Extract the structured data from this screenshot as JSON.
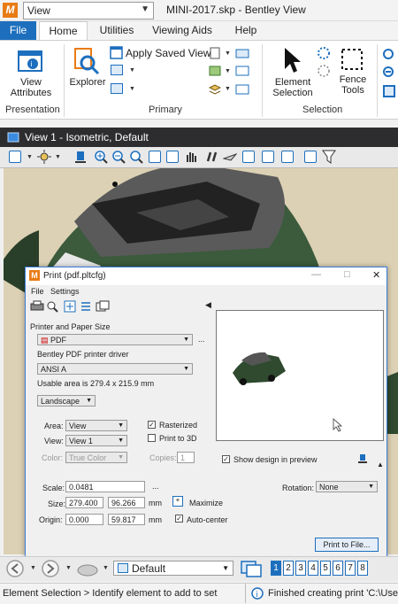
{
  "titlebar": {
    "view_selector": "View",
    "title": "MINI-2017.skp - Bentley View",
    "logo": "app-logo"
  },
  "tabs": [
    {
      "label": "File"
    },
    {
      "label": "Home"
    },
    {
      "label": "Utilities"
    },
    {
      "label": "Viewing Aids"
    },
    {
      "label": "Help"
    }
  ],
  "ribbon": {
    "presentation": {
      "group": "Presentation",
      "view_attributes": "View\nAttributes"
    },
    "primary": {
      "group": "Primary",
      "explorer": "Explorer",
      "apply_saved_view": "Apply Saved View"
    },
    "selection": {
      "group": "Selection",
      "element_selection": "Element\nSelection",
      "fence_tools": "Fence\nTools"
    }
  },
  "view_window": {
    "title": "View 1 - Isometric, Default"
  },
  "print_dialog": {
    "title": "Print (pdf.pltcfg)",
    "menu": [
      "File",
      "Settings"
    ],
    "printer_section": "Printer and Paper Size",
    "printer": "PDF",
    "driver": "Bentley PDF printer driver",
    "paper": "ANSI A",
    "usable_area": "Usable area is 279.4 x 215.9 mm",
    "orientation": "Landscape",
    "area_label": "Area:",
    "area_value": "View",
    "view_label": "View:",
    "view_value": "View 1",
    "color_label": "Color:",
    "color_value": "True Color",
    "copies_label": "Copies:",
    "copies_value": "1",
    "rasterized": "Rasterized",
    "print_to_3d": "Print to 3D",
    "show_design": "Show design in preview",
    "scale_label": "Scale:",
    "scale_value": "0.0481",
    "size_label": "Size:",
    "size_w": "279.400",
    "size_h": "96.266",
    "size_unit": "mm",
    "maximize": "Maximize",
    "origin_label": "Origin:",
    "origin_x": "0.000",
    "origin_y": "59.817",
    "origin_unit": "mm",
    "auto_center": "Auto-center",
    "rotation_label": "Rotation:",
    "rotation_value": "None",
    "ellipsis": "...",
    "print_button": "Print to File..."
  },
  "bottom_bar": {
    "model": "Default",
    "views": [
      "1",
      "2",
      "3",
      "4",
      "5",
      "6",
      "7",
      "8"
    ]
  },
  "status": {
    "left": "Element Selection > Identify element to add to set",
    "right": "Finished creating print 'C:\\Use"
  },
  "colors": {
    "accent": "#1d6fbe",
    "view_titlebar": "#2d2d30",
    "viewport_bg": "#dcd1b4",
    "logo": "#e97b14"
  }
}
